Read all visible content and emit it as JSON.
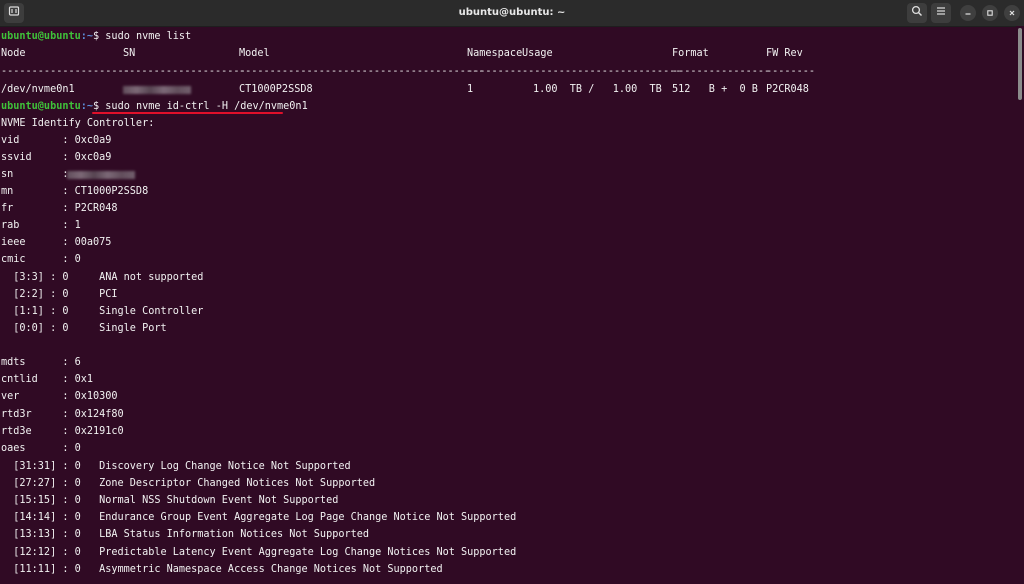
{
  "window": {
    "title": "ubuntu@ubuntu: ~"
  },
  "colors": {
    "background": "#300a24",
    "prompt_user": "#3fc23a",
    "prompt_path": "#5b8bd6",
    "highlight_underline": "#e0102a"
  },
  "icons": {
    "new_tab": "new-tab-icon",
    "search": "search-icon",
    "menu": "hamburger-menu-icon",
    "minimize": "minimize-icon",
    "maximize": "maximize-icon",
    "close": "close-icon"
  },
  "prompt": {
    "user_host": "ubuntu@ubuntu",
    "path": ":~",
    "symbol": "$ "
  },
  "commands": {
    "first": "sudo nvme list",
    "second": "sudo nvme id-ctrl -H /dev/nvme0n1"
  },
  "nvme_list": {
    "headers": [
      "Node",
      "SN",
      "Model",
      "Namespace",
      "Usage",
      "Format",
      "FW Rev"
    ],
    "separators": [
      "---------------------",
      "--------------------",
      "----------------------------------------",
      "---------",
      "--------------------------",
      "----------------",
      "--------"
    ],
    "row": {
      "node": "/dev/nvme0n1",
      "model": "CT1000P2SSD8",
      "namespace": "1",
      "usage": "1.00  TB /   1.00  TB",
      "format": "512   B +  0 B",
      "fw_rev": "P2CR048"
    }
  },
  "output_lines": [
    "NVME Identify Controller:",
    "vid       : 0xc0a9",
    "ssvid     : 0xc0a9",
    "sn        : ",
    "mn        : CT1000P2SSD8",
    "fr        : P2CR048",
    "rab       : 1",
    "ieee      : 00a075",
    "cmic      : 0",
    "  [3:3] : 0     ANA not supported",
    "  [2:2] : 0     PCI",
    "  [1:1] : 0     Single Controller",
    "  [0:0] : 0     Single Port",
    "",
    "mdts      : 6",
    "cntlid    : 0x1",
    "ver       : 0x10300",
    "rtd3r     : 0x124f80",
    "rtd3e     : 0x2191c0",
    "oaes      : 0",
    "  [31:31] : 0   Discovery Log Change Notice Not Supported",
    "  [27:27] : 0   Zone Descriptor Changed Notices Not Supported",
    "  [15:15] : 0   Normal NSS Shutdown Event Not Supported",
    "  [14:14] : 0   Endurance Group Event Aggregate Log Page Change Notice Not Supported",
    "  [13:13] : 0   LBA Status Information Notices Not Supported",
    "  [12:12] : 0   Predictable Latency Event Aggregate Log Change Notices Not Supported",
    "  [11:11] : 0   Asymmetric Namespace Access Change Notices Not Supported"
  ]
}
